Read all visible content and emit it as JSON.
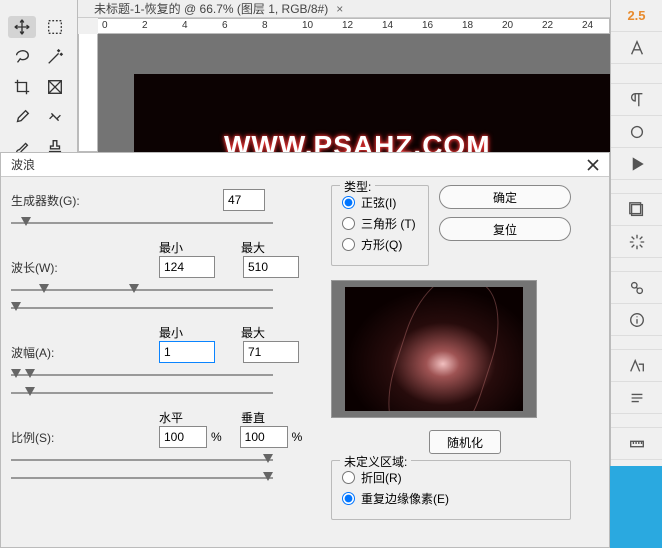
{
  "doc_tab": {
    "title": "未标题-1-恢复的 @ 66.7% (图层 1, RGB/8#)",
    "close": "×"
  },
  "ruler": {
    "marks": [
      "0",
      "2",
      "4",
      "6",
      "8",
      "10",
      "12",
      "14",
      "16",
      "18",
      "20",
      "22",
      "24"
    ]
  },
  "canvas_text": "WWW.PSAHZ.COM",
  "right_panel_accent": "2.5",
  "dialog": {
    "title": "波浪",
    "generators_label": "生成器数(G):",
    "generators_value": "47",
    "min_label": "最小",
    "max_label": "最大",
    "wavelength_label": "波长(W):",
    "wavelength_min": "124",
    "wavelength_max": "510",
    "amplitude_label": "波幅(A):",
    "amplitude_min": "1",
    "amplitude_max": "71",
    "horiz_label": "水平",
    "vert_label": "垂直",
    "scale_label": "比例(S):",
    "scale_h": "100",
    "scale_v": "100",
    "pct": "%",
    "type_legend": "类型:",
    "type_sine": "正弦(I)",
    "type_tri": "三角形 (T)",
    "type_square": "方形(Q)",
    "ok": "确定",
    "reset": "复位",
    "randomize": "随机化",
    "undef_legend": "未定义区域:",
    "undef_wrap": "折回(R)",
    "undef_repeat": "重复边缘像素(E)"
  }
}
